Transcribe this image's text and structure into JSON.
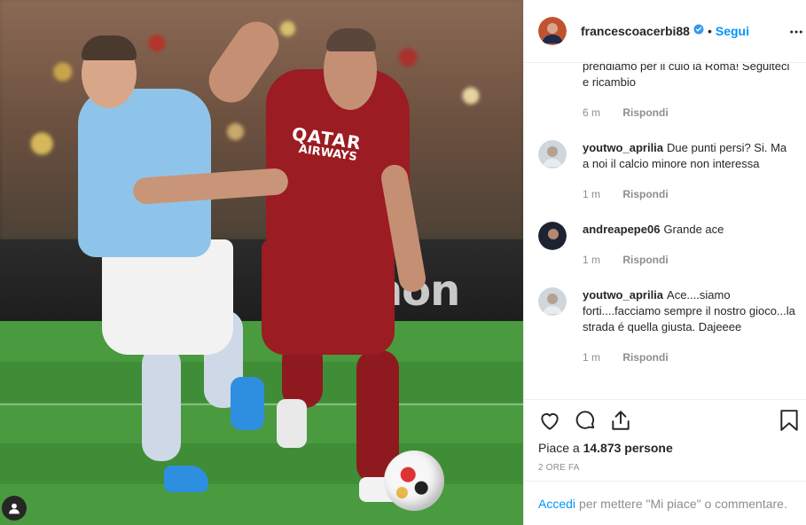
{
  "post": {
    "username": "francescoacerbi88",
    "follow_label": "Segui",
    "separator": "•",
    "verified_icon": "verified-badge-icon",
    "more_icon": "more-options-icon"
  },
  "photo": {
    "sponsor_line1": "QATAR",
    "sponsor_line2": "AIRWAYS",
    "board_text": "non"
  },
  "comments": [
    {
      "user": "",
      "text": "prendiamo per il culo la Roma! Seguiteci e ricambio",
      "time": "6 m",
      "reply": "Rispondi"
    },
    {
      "user": "youtwo_aprilia",
      "text": "Due punti persi? Si. Ma a noi il calcio minore non interessa",
      "time": "1 m",
      "reply": "Rispondi"
    },
    {
      "user": "andreapepe06",
      "text": "Grande ace",
      "time": "1 m",
      "reply": "Rispondi"
    },
    {
      "user": "youtwo_aprilia",
      "text": "Ace....siamo forti....facciamo sempre il nostro gioco...la strada é quella giusta. Dajeeee",
      "time": "1 m",
      "reply": "Rispondi"
    }
  ],
  "actions": {
    "like_icon": "heart-icon",
    "comment_icon": "comment-icon",
    "share_icon": "share-icon",
    "save_icon": "bookmark-icon",
    "likes_prefix": "Piace a ",
    "likes_count": "14.873",
    "likes_suffix": " persone",
    "time_ago": "2 ORE FA"
  },
  "footer": {
    "login_link": "Accedi",
    "prompt": "per mettere \"Mi piace\" o commentare."
  },
  "colors": {
    "link_blue": "#0095f6",
    "secondary_gray": "#8e8e8e",
    "text_dark": "#262626"
  }
}
